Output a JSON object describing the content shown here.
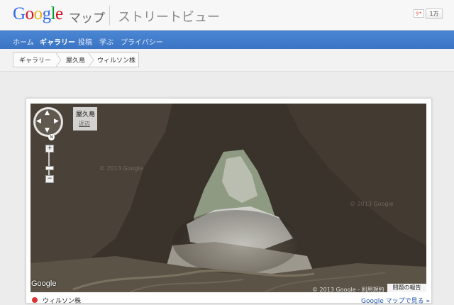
{
  "header": {
    "logo_letters": [
      {
        "ch": "G",
        "color": "#3369e8"
      },
      {
        "ch": "o",
        "color": "#d50f25"
      },
      {
        "ch": "o",
        "color": "#eeb211"
      },
      {
        "ch": "g",
        "color": "#3369e8"
      },
      {
        "ch": "l",
        "color": "#009925"
      },
      {
        "ch": "e",
        "color": "#d50f25"
      }
    ],
    "product": "マップ",
    "subtitle": "ストリートビュー",
    "share_label": "1万"
  },
  "nav": {
    "items": [
      {
        "label": "ホーム",
        "active": false
      },
      {
        "label": "ギャラリー",
        "active": true
      },
      {
        "label": "投稿",
        "active": false
      },
      {
        "label": "学ぶ",
        "active": false
      },
      {
        "label": "プライバシー",
        "active": false
      }
    ]
  },
  "breadcrumb": [
    "ギャラリー",
    "屋久島",
    "ウィルソン株"
  ],
  "viewer": {
    "location_name": "屋久島",
    "nearby_label": "近辺",
    "compass_label": "N",
    "watermark": "© 2013 Google",
    "brand": "Google",
    "copyright": "© 2013 Google - 利用規約",
    "report_label": "問題の報告"
  },
  "below": {
    "place_name": "ウィルソン株",
    "maps_link": "Google マップで見る »"
  },
  "colors": {
    "nav_blue": "#3f7bcb",
    "marker_red": "#dd3333"
  }
}
